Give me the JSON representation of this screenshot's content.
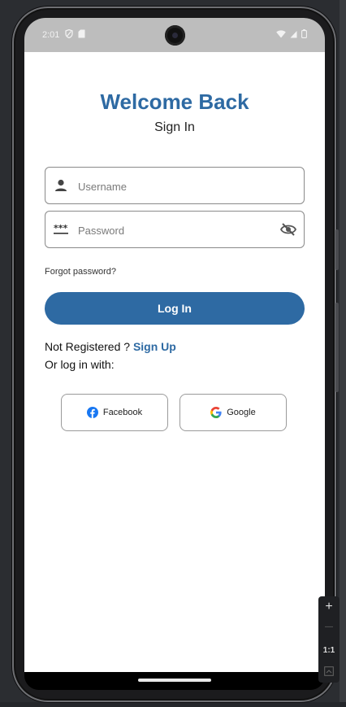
{
  "status_bar": {
    "time": "2:01"
  },
  "login": {
    "title": "Welcome Back",
    "subtitle": "Sign In",
    "username_placeholder": "Username",
    "password_placeholder": "Password",
    "password_mask_icon_text": "***",
    "forgot_password": "Forgot password?",
    "login_button": "Log In",
    "not_registered": "Not Registered ? ",
    "sign_up": "Sign Up",
    "or_log_in_with": "Or log in with:"
  },
  "social": {
    "facebook": "Facebook",
    "google": "Google"
  },
  "emulator_controls": {
    "zoom_in": "+",
    "zoom_out": "—",
    "actual_size": "1:1"
  },
  "colors": {
    "primary": "#2e6aa3",
    "facebook": "#1877f2",
    "status_bar_bg": "#bdbdbd"
  }
}
